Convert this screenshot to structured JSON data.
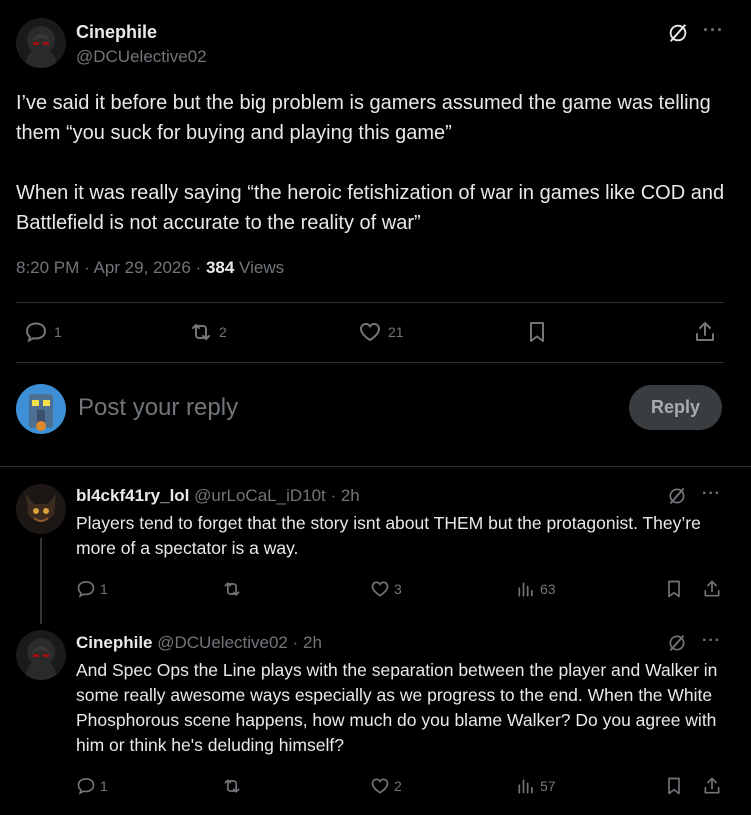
{
  "post": {
    "author_name": "Cinephile",
    "author_handle": "@DCUelective02",
    "text": "I’ve said it before but the big problem is gamers assumed the game was telling them “you suck for buying and playing this game”\n\nWhen it was really saying “the heroic fetishization of war in games like COD and Battlefield is not accurate to the reality of war”",
    "time": "8:20 PM · Apr 29, 2026 · ",
    "views_count": "384",
    "views_label": " Views",
    "reply_count": "1",
    "repost_count": "2",
    "like_count": "21"
  },
  "composer": {
    "placeholder": "Post your reply",
    "reply_label": "Reply"
  },
  "replies": [
    {
      "author_name": "bl4ckf41ry_lol",
      "author_handle": "@urLoCaL_iD10t · 2h",
      "text": "Players tend to forget that the story isnt about THEM but the protagonist. They’re more of a spectator is a way.",
      "reply_count": "1",
      "repost_count": "",
      "like_count": "3",
      "view_count": "63"
    },
    {
      "author_name": "Cinephile",
      "author_handle": "@DCUelective02 · 2h",
      "text": "And Spec Ops the Line plays with the separation between the player and Walker in some really awesome ways especially as we progress to the end. When the White Phosphorous scene happens, how much do you blame Walker? Do you agree with him or think he's deluding himself?",
      "reply_count": "1",
      "repost_count": "",
      "like_count": "2",
      "view_count": "57"
    }
  ],
  "icons": {
    "more": "···",
    "accent": "#1d9bf0"
  }
}
